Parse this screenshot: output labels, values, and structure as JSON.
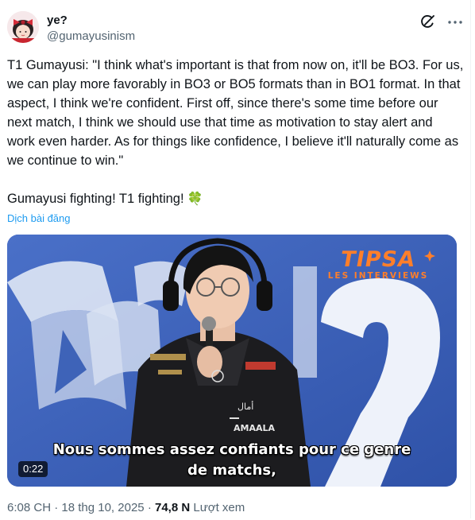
{
  "author": {
    "name": "ye?",
    "handle": "@gumayusinism",
    "avatar_icon": "avatar-girl-with-bow"
  },
  "tweet": {
    "paragraph1": "T1 Gumayusi: \"I think what's important is that from now on, it'll be BO3. For us, we can play more favorably in BO3 or BO5 formats than in BO1 format. In that aspect, I think we're confident. First off, since there's some time before our next match, I think we should use that time as motivation to stay alert and work even harder. As for things like confidence, I believe it'll naturally come as we continue to win.\"",
    "paragraph2": "Gumayusi fighting! T1 fighting!",
    "emoji": "🍀",
    "translate_label": "Dịch bài đăng"
  },
  "media": {
    "brand_title": "TIPSA",
    "brand_subtitle": "LES INTERVIEWS",
    "jersey_text_1": "أمال",
    "jersey_text_2": "AMAALA",
    "subtitle_line1": "Nous sommes assez confiants pour ce genre",
    "subtitle_line2": "de matchs,",
    "duration": "0:22"
  },
  "meta": {
    "time": "6:08 CH",
    "separator": "·",
    "date": "18 thg 10, 2025",
    "views_count": "74,8 N",
    "views_label": "Lượt xem"
  },
  "colors": {
    "link": "#1d9bf0",
    "brand_orange": "#ff7f2a",
    "media_background": "#3e63b8"
  }
}
